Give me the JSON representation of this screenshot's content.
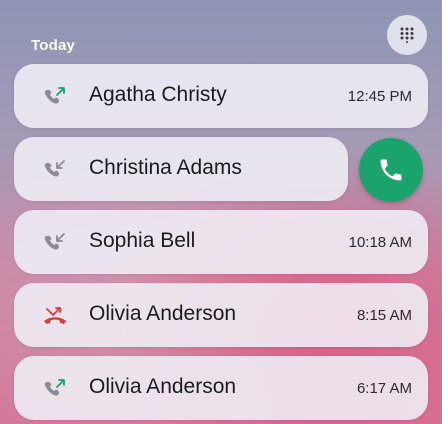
{
  "section": {
    "title": "Today"
  },
  "icons": {
    "dialpad": "dialpad-icon",
    "call": "phone-icon",
    "outgoing": "outgoing-call-icon",
    "incoming": "incoming-call-icon",
    "missed": "missed-call-icon"
  },
  "colors": {
    "call_accent": "#1aa36b",
    "outgoing_arrow": "#1aa36b",
    "missed": "#e53935",
    "card_bg": "#eeecf4"
  },
  "calls": [
    {
      "name": "Agatha Christy",
      "time": "12:45 PM",
      "type": "outgoing"
    },
    {
      "name": "Christina Adams",
      "time": "",
      "type": "incoming"
    },
    {
      "name": "Sophia Bell",
      "time": "10:18 AM",
      "type": "incoming"
    },
    {
      "name": "Olivia Anderson",
      "time": "8:15 AM",
      "type": "missed"
    },
    {
      "name": "Olivia Anderson",
      "time": "6:17 AM",
      "type": "outgoing"
    }
  ]
}
